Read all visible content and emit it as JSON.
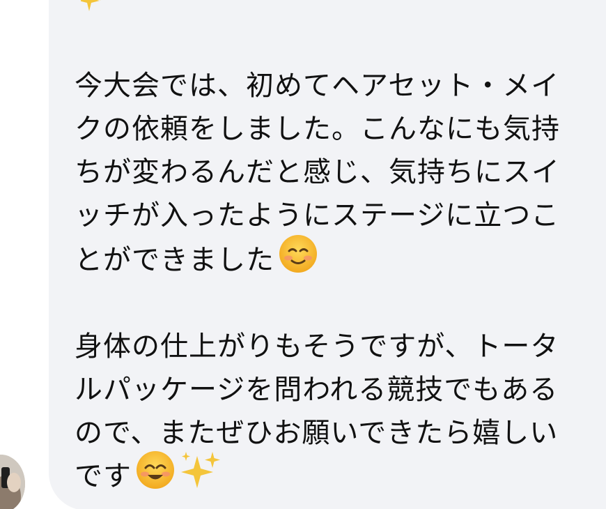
{
  "message": {
    "lines": [
      "今大会では、初めてヘアセット・メイ",
      "クの依頼をしました。こんなにも気持",
      "ちが変わるんだと感じ、気持ちにスイ",
      "ッチが入ったようにステージに立つこ",
      "とができました",
      "身体の仕上がりもそうですが、トータ",
      "ルパッケージを問われる競技でもある",
      "ので、またぜひお願いできたら嬉しい",
      "です"
    ],
    "emojis": {
      "top_sparkle": "sparkles-icon",
      "line5_emoji": "smiling-face-icon",
      "line9_emoji1": "smiling-face-with-smiling-eyes-icon",
      "line9_emoji2": "sparkles-icon"
    }
  },
  "colors": {
    "bubble_background": "#f2f3f6",
    "text": "#111111",
    "emoji_face": "#f7c334",
    "sparkle": "#f4c53b"
  }
}
